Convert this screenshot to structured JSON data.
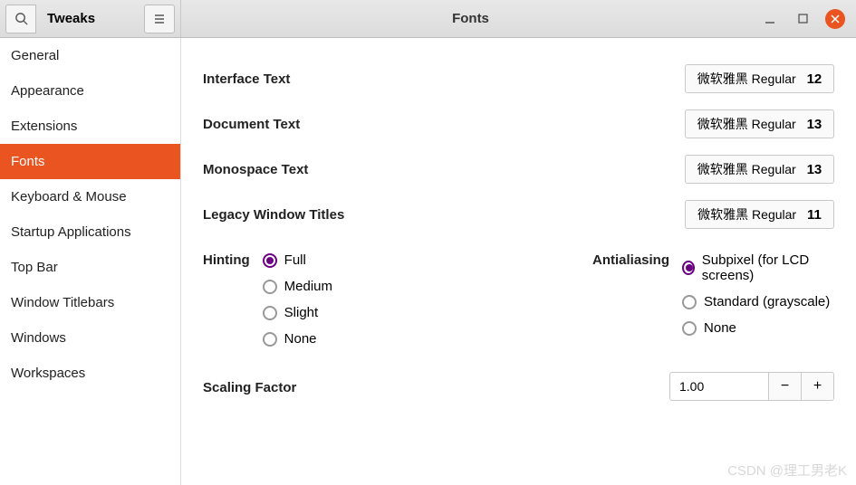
{
  "window": {
    "app_title": "Tweaks",
    "page_title": "Fonts"
  },
  "sidebar": {
    "items": [
      {
        "label": "General"
      },
      {
        "label": "Appearance"
      },
      {
        "label": "Extensions"
      },
      {
        "label": "Fonts"
      },
      {
        "label": "Keyboard & Mouse"
      },
      {
        "label": "Startup Applications"
      },
      {
        "label": "Top Bar"
      },
      {
        "label": "Window Titlebars"
      },
      {
        "label": "Windows"
      },
      {
        "label": "Workspaces"
      }
    ],
    "active": 3
  },
  "fonts": {
    "rows": [
      {
        "label": "Interface Text",
        "font": "微软雅黑 Regular",
        "size": "12"
      },
      {
        "label": "Document Text",
        "font": "微软雅黑 Regular",
        "size": "13"
      },
      {
        "label": "Monospace Text",
        "font": "微软雅黑 Regular",
        "size": "13"
      },
      {
        "label": "Legacy Window Titles",
        "font": "微软雅黑 Regular",
        "size": "11"
      }
    ]
  },
  "hinting": {
    "label": "Hinting",
    "options": [
      "Full",
      "Medium",
      "Slight",
      "None"
    ],
    "selected": 0
  },
  "antialiasing": {
    "label": "Antialiasing",
    "options": [
      "Subpixel (for LCD screens)",
      "Standard (grayscale)",
      "None"
    ],
    "selected": 0
  },
  "scaling": {
    "label": "Scaling Factor",
    "value": "1.00"
  },
  "watermark": "CSDN @理工男老K"
}
